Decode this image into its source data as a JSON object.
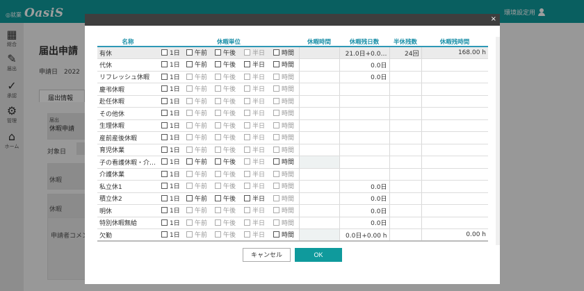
{
  "header": {
    "brand_small": "◎就業",
    "brand_big": "OasiS",
    "user_label": "環境設定用"
  },
  "sidenav": {
    "items": [
      {
        "label": "総合",
        "icon": "grid-icon"
      },
      {
        "label": "届出",
        "icon": "pencil-icon"
      },
      {
        "label": "承認",
        "icon": "check-icon"
      },
      {
        "label": "管理",
        "icon": "gear-icon"
      },
      {
        "label": "ホーム",
        "icon": "home-icon"
      }
    ]
  },
  "background": {
    "title": "届出申請",
    "date_label": "申請日　2022",
    "tab": "届出情報",
    "notif_small": "届出",
    "notif_value": "休暇申請",
    "target_label": "対象日",
    "leave_label_1": "休暇",
    "leave_label_2": "休暇",
    "comment_label": "申請者コメン"
  },
  "modal": {
    "close": "×",
    "columns": {
      "name": "名称",
      "unit": "休暇単位",
      "hours": "休暇時間",
      "remain_days": "休暇残日数",
      "half_remain": "半休残数",
      "remain_hours": "休暇残時間"
    },
    "unit_labels": [
      "1日",
      "午前",
      "午後",
      "半日",
      "時間"
    ],
    "rows": [
      {
        "name": "有休",
        "enabled": [
          true,
          true,
          true,
          false,
          true
        ],
        "remain_days": "21.0日+0.0…",
        "half_remain": "24回",
        "remain_hours": "168.00 h",
        "shade": false
      },
      {
        "name": "代休",
        "enabled": [
          true,
          true,
          true,
          true,
          true
        ],
        "remain_days": "0.0日",
        "half_remain": "",
        "remain_hours": "",
        "shade": false
      },
      {
        "name": "リフレッシュ休暇",
        "enabled": [
          true,
          false,
          false,
          false,
          false
        ],
        "remain_days": "0.0日",
        "half_remain": "",
        "remain_hours": "",
        "shade": false
      },
      {
        "name": "慶弔休暇",
        "enabled": [
          true,
          false,
          false,
          false,
          false
        ],
        "remain_days": "",
        "half_remain": "",
        "remain_hours": "",
        "shade": false
      },
      {
        "name": "赴任休暇",
        "enabled": [
          true,
          false,
          false,
          false,
          false
        ],
        "remain_days": "",
        "half_remain": "",
        "remain_hours": "",
        "shade": false
      },
      {
        "name": "その他休",
        "enabled": [
          true,
          false,
          false,
          false,
          false
        ],
        "remain_days": "",
        "half_remain": "",
        "remain_hours": "",
        "shade": false
      },
      {
        "name": "生理休暇",
        "enabled": [
          true,
          false,
          false,
          false,
          false
        ],
        "remain_days": "",
        "half_remain": "",
        "remain_hours": "",
        "shade": false
      },
      {
        "name": "産前産後休暇",
        "enabled": [
          true,
          false,
          false,
          false,
          false
        ],
        "remain_days": "",
        "half_remain": "",
        "remain_hours": "",
        "shade": false
      },
      {
        "name": "育児休業",
        "enabled": [
          true,
          false,
          false,
          false,
          false
        ],
        "remain_days": "",
        "half_remain": "",
        "remain_hours": "",
        "shade": false
      },
      {
        "name": "子の看護休暇・介…",
        "enabled": [
          true,
          true,
          true,
          false,
          true
        ],
        "remain_days": "",
        "half_remain": "",
        "remain_hours": "",
        "shade": true
      },
      {
        "name": "介護休業",
        "enabled": [
          true,
          false,
          false,
          false,
          false
        ],
        "remain_days": "",
        "half_remain": "",
        "remain_hours": "",
        "shade": false
      },
      {
        "name": "私立休1",
        "enabled": [
          true,
          false,
          false,
          false,
          false
        ],
        "remain_days": "0.0日",
        "half_remain": "",
        "remain_hours": "",
        "shade": false
      },
      {
        "name": "積立休2",
        "enabled": [
          true,
          true,
          true,
          true,
          false
        ],
        "remain_days": "0.0日",
        "half_remain": "",
        "remain_hours": "",
        "shade": false
      },
      {
        "name": "明休",
        "enabled": [
          true,
          false,
          false,
          false,
          false
        ],
        "remain_days": "0.0日",
        "half_remain": "",
        "remain_hours": "",
        "shade": false
      },
      {
        "name": "特別休暇無給",
        "enabled": [
          true,
          false,
          false,
          false,
          false
        ],
        "remain_days": "0.0日",
        "half_remain": "",
        "remain_hours": "",
        "shade": false
      },
      {
        "name": "欠勤",
        "enabled": [
          true,
          false,
          false,
          false,
          true
        ],
        "remain_days": "0.0日+0.00 h",
        "half_remain": "",
        "remain_hours": "0.00 h",
        "shade": true
      }
    ],
    "cancel_label": "キャンセル",
    "ok_label": "OK"
  }
}
